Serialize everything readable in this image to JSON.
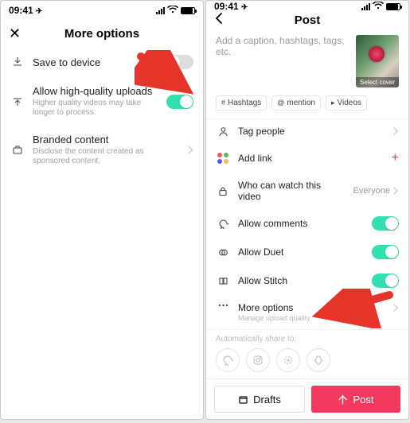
{
  "status": {
    "time": "09:41"
  },
  "left": {
    "title": "More options",
    "rows": {
      "save": {
        "label": "Save to device"
      },
      "hq": {
        "label": "Allow high-quality uploads",
        "sub": "Higher quality videos may take longer to process."
      },
      "branded": {
        "label": "Branded content",
        "sub": "Disclose the content created as sponsored content."
      }
    }
  },
  "right": {
    "title": "Post",
    "caption_placeholder": "Add a caption, hashtags, tags, etc.",
    "select_cover": "Select cover",
    "chips": {
      "hashtags": "Hashtags",
      "mention": "mention",
      "videos": "Videos"
    },
    "rows": {
      "tag": "Tag people",
      "link": "Add link",
      "privacy": {
        "label": "Who can watch this video",
        "value": "Everyone"
      },
      "comments": "Allow comments",
      "duet": "Allow Duet",
      "stitch": "Allow Stitch",
      "more": {
        "label": "More options",
        "sub": "Manage upload quality"
      }
    },
    "autoshare": "Automatically share to:",
    "drafts": "Drafts",
    "post": "Post"
  }
}
